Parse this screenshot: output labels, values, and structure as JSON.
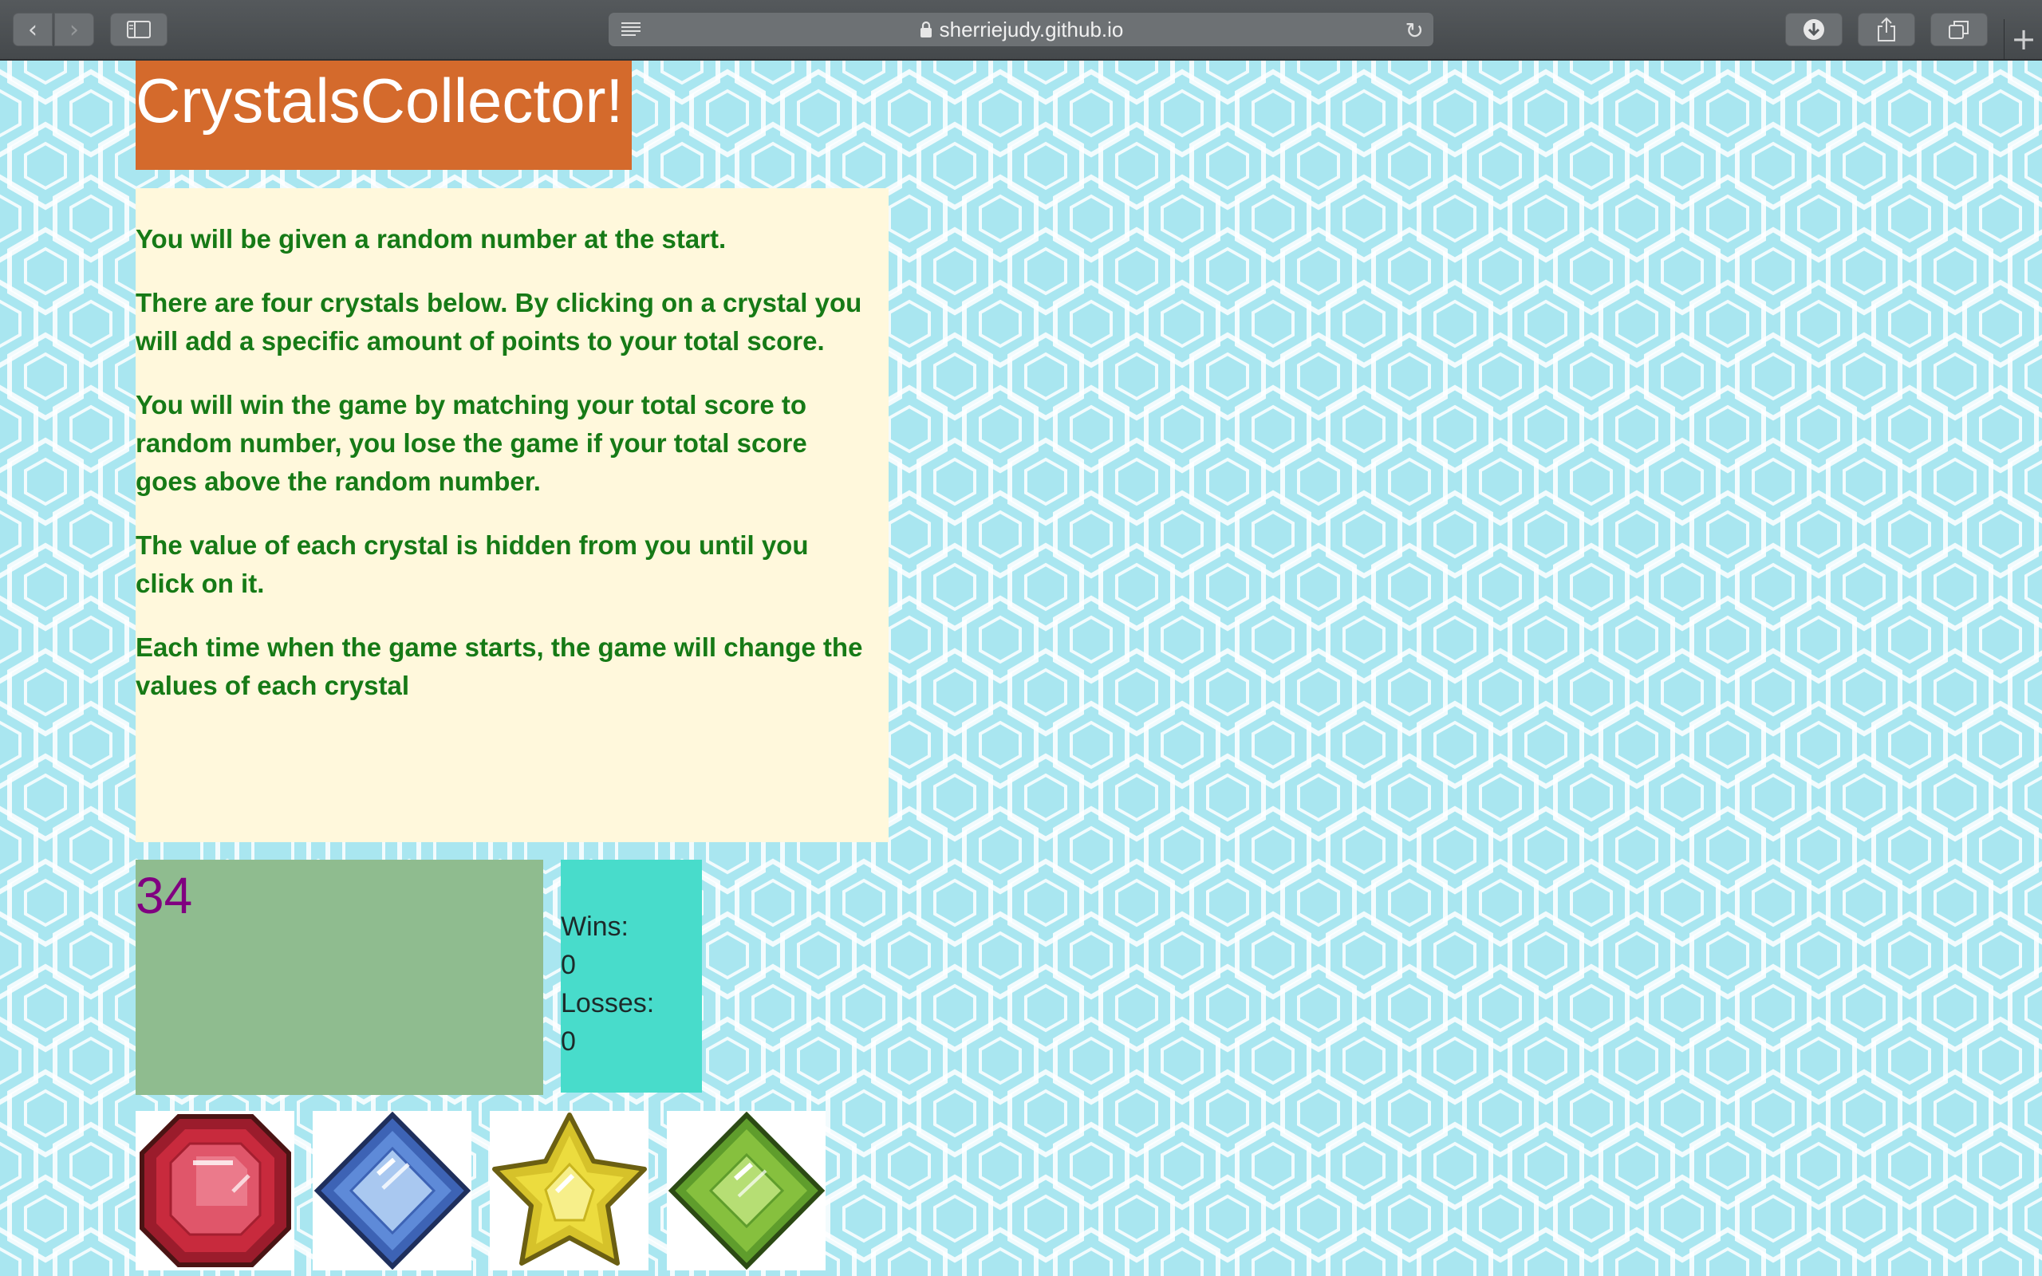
{
  "browser": {
    "url": "sherriejudy.github.io",
    "back_icon": "‹",
    "forward_icon": "›",
    "reload_icon": "↻",
    "new_tab_icon": "+"
  },
  "game": {
    "title": "CrystalsCollector!",
    "instructions": [
      "You will be given a random number at the start.",
      "There are four crystals below. By clicking on a crystal you will add a specific amount of points to your total score.",
      "You will win the game by matching your total score to random number, you lose the game if your total score goes above the random number.",
      "The value of each crystal is hidden from you until you click on it.",
      "Each time when the game starts, the game will change the values of each crystal"
    ],
    "target_number": "34",
    "wins_label": "Wins:",
    "wins_value": "0",
    "losses_label": "Losses:",
    "losses_value": "0",
    "crystals": [
      "red-gem-icon",
      "blue-gem-icon",
      "yellow-gem-icon",
      "green-gem-icon"
    ]
  },
  "colors": {
    "title_bg": "#d46a2c",
    "instructions_bg": "#fff8dc",
    "instructions_text": "#167a16",
    "target_bg": "#8fbc8f",
    "target_text": "#800080",
    "score_bg": "#48dccb",
    "page_bg": "#a9e6f0"
  }
}
